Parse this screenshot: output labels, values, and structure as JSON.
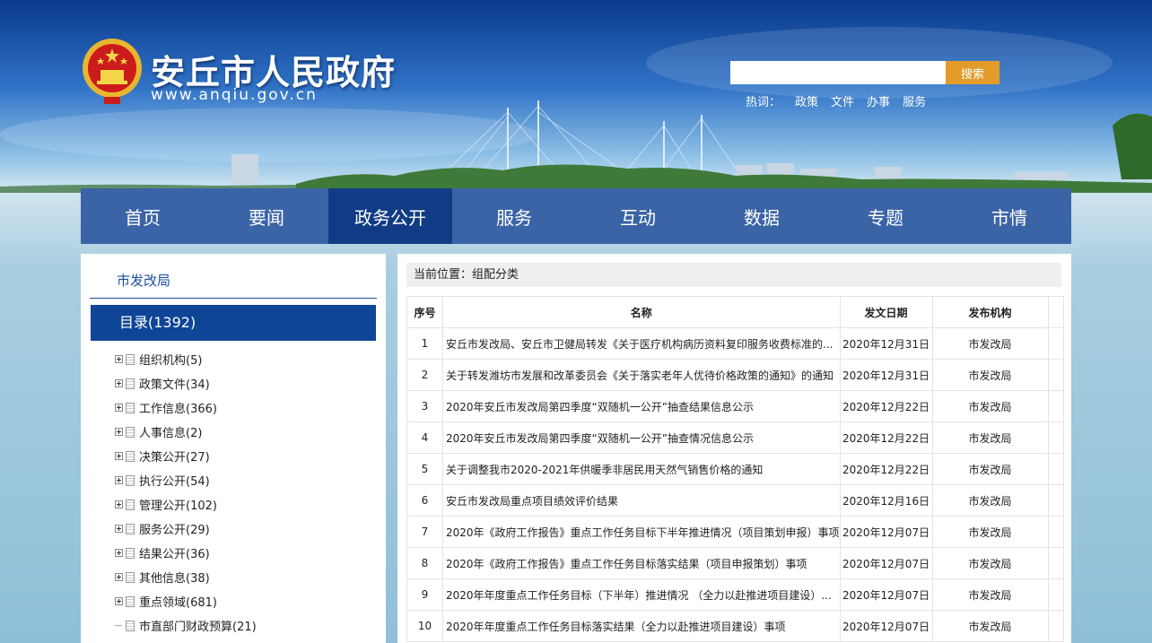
{
  "header": {
    "site_title": "安丘市人民政府",
    "site_url": "www.anqiu.gov.cn",
    "search": {
      "placeholder": "",
      "button_label": "搜索"
    },
    "hotwords": {
      "label": "热词：",
      "items": [
        "政策",
        "文件",
        "办事",
        "服务"
      ]
    }
  },
  "nav": {
    "items": [
      "首页",
      "要闻",
      "政务公开",
      "服务",
      "互动",
      "数据",
      "专题",
      "市情"
    ],
    "active": "政务公开"
  },
  "sidebar": {
    "department": "市发改局",
    "catalog_header": "目录(1392)",
    "tree": [
      {
        "label": "组织机构(5)",
        "expandable": true
      },
      {
        "label": "政策文件(34)",
        "expandable": true
      },
      {
        "label": "工作信息(366)",
        "expandable": true
      },
      {
        "label": "人事信息(2)",
        "expandable": true
      },
      {
        "label": "决策公开(27)",
        "expandable": true
      },
      {
        "label": "执行公开(54)",
        "expandable": true
      },
      {
        "label": "管理公开(102)",
        "expandable": true
      },
      {
        "label": "服务公开(29)",
        "expandable": true
      },
      {
        "label": "结果公开(36)",
        "expandable": true
      },
      {
        "label": "其他信息(38)",
        "expandable": true
      },
      {
        "label": "重点领域(681)",
        "expandable": true
      },
      {
        "label": "市直部门财政预算(21)",
        "expandable": false
      }
    ]
  },
  "main": {
    "location": "当前位置：组配分类",
    "table": {
      "headers": [
        "序号",
        "名称",
        "发文日期",
        "发布机构"
      ],
      "rows": [
        [
          "1",
          "安丘市发改局、安丘市卫健局转发《关于医疗机构病历资料复印服务收费标准的...",
          "2020年12月31日",
          "市发改局"
        ],
        [
          "2",
          "关于转发潍坊市发展和改革委员会《关于落实老年人优待价格政策的通知》的通知",
          "2020年12月31日",
          "市发改局"
        ],
        [
          "3",
          "2020年安丘市发改局第四季度“双随机一公开”抽查结果信息公示",
          "2020年12月22日",
          "市发改局"
        ],
        [
          "4",
          "2020年安丘市发改局第四季度“双随机一公开”抽查情况信息公示",
          "2020年12月22日",
          "市发改局"
        ],
        [
          "5",
          "关于调整我市2020-2021年供暖季非居民用天然气销售价格的通知",
          "2020年12月22日",
          "市发改局"
        ],
        [
          "6",
          "安丘市发改局重点项目绩效评价结果",
          "2020年12月16日",
          "市发改局"
        ],
        [
          "7",
          "2020年《政府工作报告》重点工作任务目标下半年推进情况（项目策划申报）事项",
          "2020年12月07日",
          "市发改局"
        ],
        [
          "8",
          "2020年《政府工作报告》重点工作任务目标落实结果（项目申报策划）事项",
          "2020年12月07日",
          "市发改局"
        ],
        [
          "9",
          "2020年年度重点工作任务目标（下半年）推进情况 （全力以赴推进项目建设）...",
          "2020年12月07日",
          "市发改局"
        ],
        [
          "10",
          "2020年年度重点工作任务目标落实结果（全力以赴推进项目建设）事项",
          "2020年12月07日",
          "市发改局"
        ]
      ]
    }
  },
  "colors": {
    "nav_bg": "#3b64a6",
    "nav_active": "#113c85",
    "search_button": "#e39b2a",
    "catalog_header": "#0e4596"
  }
}
